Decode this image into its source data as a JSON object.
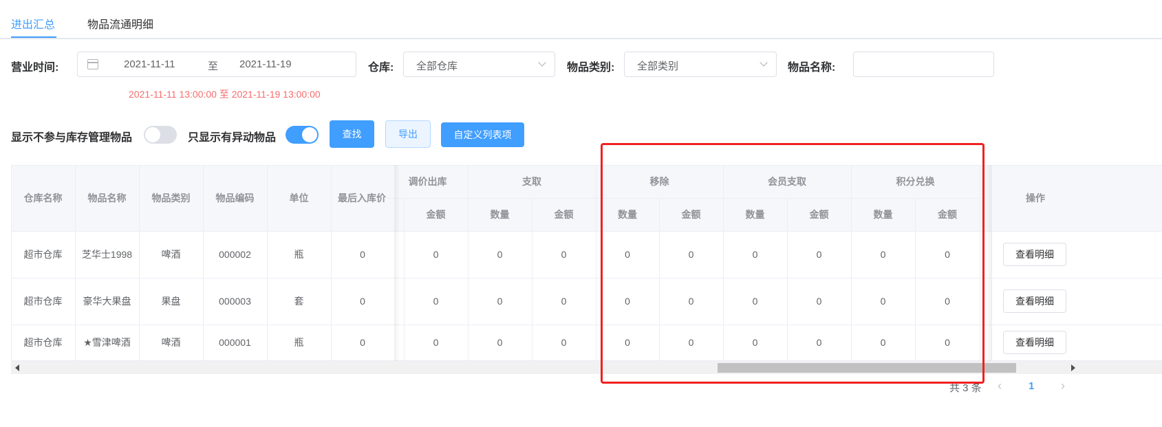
{
  "tabs": [
    {
      "label": "进出汇总",
      "active": true
    },
    {
      "label": "物品流通明细",
      "active": false
    }
  ],
  "filters": {
    "time_label": "营业时间:",
    "start_date": "2021-11-11",
    "range_sep": "至",
    "end_date": "2021-11-19",
    "hint": "2021-11-11 13:00:00 至 2021-11-19 13:00:00",
    "warehouse_label": "仓库:",
    "warehouse_value": "全部仓库",
    "category_label": "物品类别:",
    "category_value": "全部类别",
    "name_label": "物品名称:",
    "name_value": ""
  },
  "toggles": {
    "show_non_managed_label": "显示不参与库存管理物品",
    "show_non_managed": false,
    "only_changed_label": "只显示有异动物品",
    "only_changed": true
  },
  "actions": {
    "search": "查找",
    "export": "导出",
    "custom_columns": "自定义列表项"
  },
  "table": {
    "fixed_headers": [
      "仓库名称",
      "物品名称",
      "物品类别",
      "物品编码",
      "单位",
      "最后入库价"
    ],
    "group_headers": [
      "调价出库",
      "支取",
      "移除",
      "会员支取",
      "积分兑换"
    ],
    "sub_headers": [
      "金额",
      "数量",
      "金额",
      "数量",
      "金额",
      "数量",
      "金额",
      "数量",
      "金额"
    ],
    "op_header": "操作",
    "rows": [
      {
        "warehouse": "超市仓库",
        "name": "芝华士1998",
        "category": "啤酒",
        "code": "000002",
        "unit": "瓶",
        "last_price": "0",
        "values": [
          "0",
          "0",
          "0",
          "0",
          "0",
          "0",
          "0",
          "0",
          "0"
        ],
        "action": "查看明细"
      },
      {
        "warehouse": "超市仓库",
        "name": "豪华大果盘",
        "category": "果盘",
        "code": "000003",
        "unit": "套",
        "last_price": "0",
        "values": [
          "0",
          "0",
          "0",
          "0",
          "0",
          "0",
          "0",
          "0",
          "0"
        ],
        "action": "查看明细"
      },
      {
        "warehouse": "超市仓库",
        "name": "★雪津啤酒",
        "category": "啤酒",
        "code": "000001",
        "unit": "瓶",
        "last_price": "0",
        "values": [
          "0",
          "0",
          "0",
          "0",
          "0",
          "0",
          "0",
          "0",
          "0"
        ],
        "action": "查看明细"
      }
    ]
  },
  "pagination": {
    "total_text": "共 3 条",
    "current_page": "1"
  },
  "colors": {
    "accent": "#409eff",
    "highlight_box": "#f02020",
    "hint": "#f56c6c"
  }
}
